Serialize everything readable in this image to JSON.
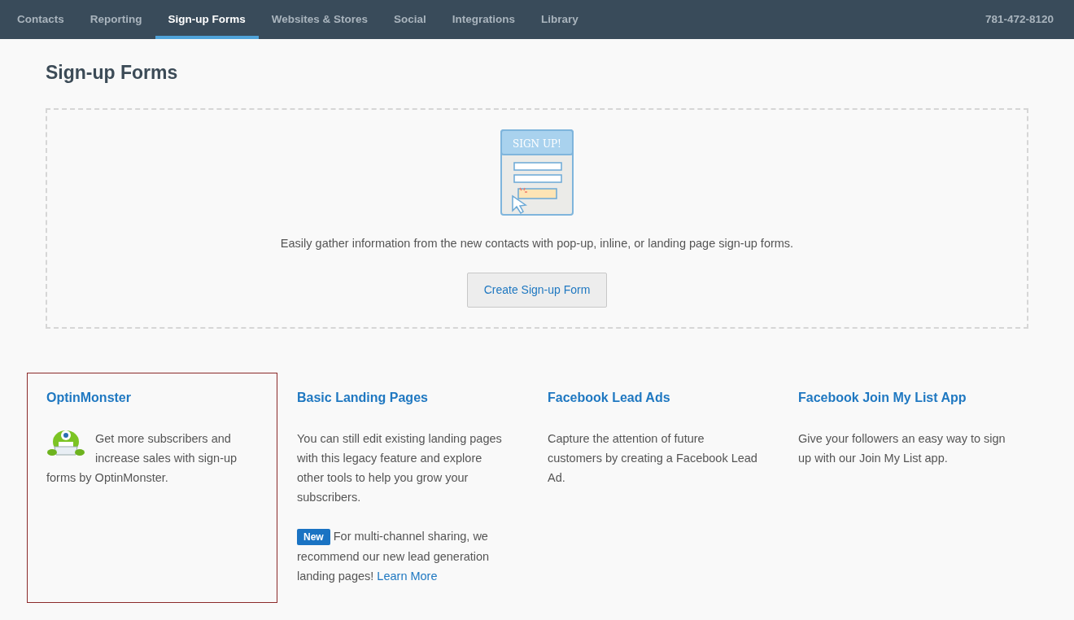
{
  "nav": {
    "tabs": [
      {
        "label": "Contacts",
        "selected": false
      },
      {
        "label": "Reporting",
        "selected": false
      },
      {
        "label": "Sign-up Forms",
        "selected": true
      },
      {
        "label": "Websites & Stores",
        "selected": false
      },
      {
        "label": "Social",
        "selected": false
      },
      {
        "label": "Integrations",
        "selected": false
      },
      {
        "label": "Library",
        "selected": false
      }
    ],
    "phone": "781-472-8120"
  },
  "page_title": "Sign-up Forms",
  "empty_state": {
    "illustration_text": "SIGN UP!",
    "description": "Easily gather information from the new contacts with pop-up, inline, or landing page sign-up forms.",
    "button": "Create Sign-up Form"
  },
  "cards": [
    {
      "title": "OptinMonster",
      "highlighted": true,
      "has_logo": true,
      "body": "Get more subscribers and increase sales with sign-up forms by OptinMonster."
    },
    {
      "title": "Basic Landing Pages",
      "highlighted": false,
      "has_logo": false,
      "body": "You can still edit existing landing pages with this legacy feature and explore other tools to help you grow your subscribers.",
      "note": {
        "badge": "New",
        "text": "For multi-channel sharing, we recommend our new lead generation landing pages!",
        "link": "Learn More"
      }
    },
    {
      "title": "Facebook Lead Ads",
      "highlighted": false,
      "has_logo": false,
      "body": "Capture the attention of future customers by creating a Facebook Lead Ad."
    },
    {
      "title": "Facebook Join My List App",
      "highlighted": false,
      "has_logo": false,
      "body": "Give your followers an easy way to sign up with our Join My List app."
    }
  ]
}
